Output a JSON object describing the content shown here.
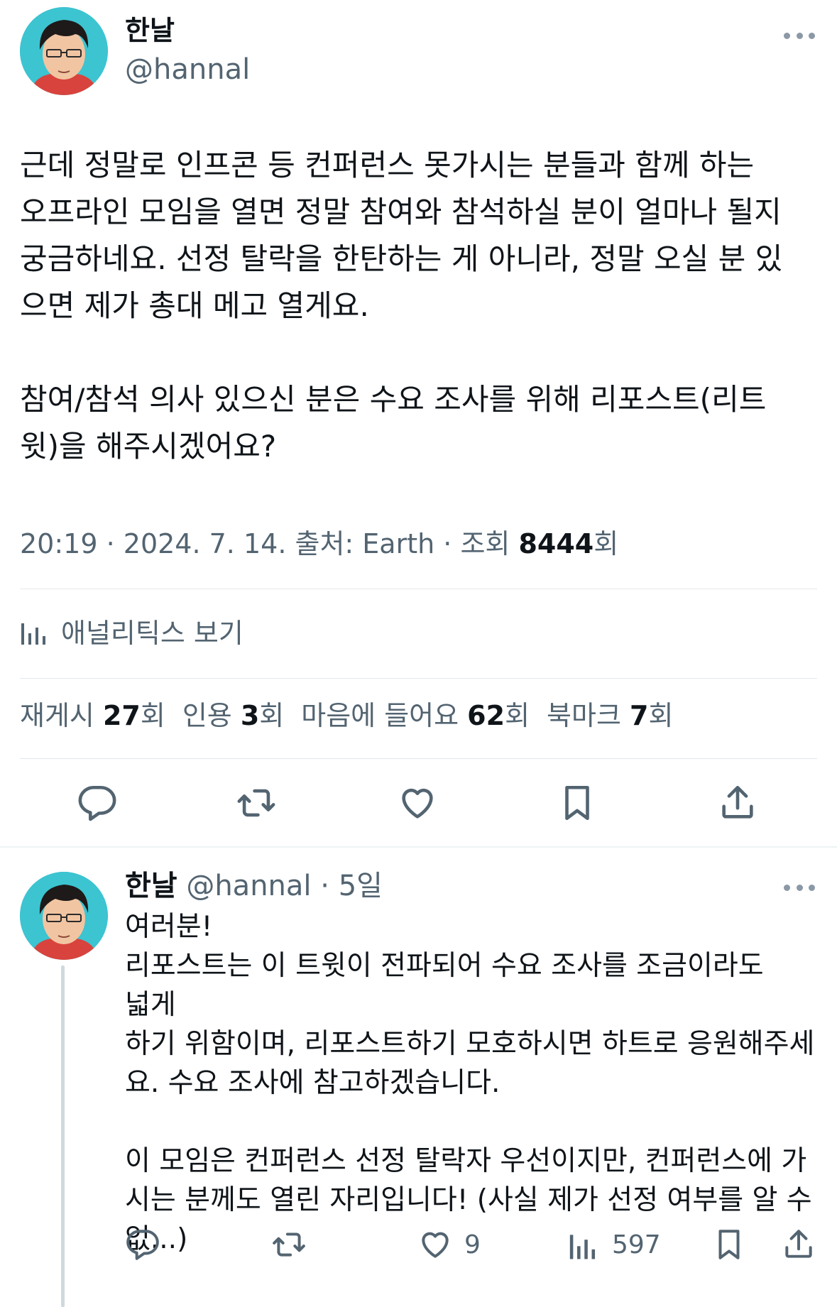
{
  "main_tweet": {
    "display_name": "한날",
    "handle": "@hannal",
    "text": "근데 정말로 인프콘 등 컨퍼런스 못가시는 분들과 함께 하는\n오프라인 모임을 열면 정말 참여와 참석하실 분이 얼마나 될지\n궁금하네요. 선정 탈락을 한탄하는 게 아니라, 정말 오실 분 있\n으면 제가 총대 메고 열게요.\n\n참여/참석 의사 있으신 분은 수요 조사를 위해 리포스트(리트\n윗)을 해주시겠어요?",
    "meta": {
      "time": "20:19",
      "sep1": " · ",
      "date": "2024. 7. 14.",
      "source_label": " 출처: ",
      "source": "Earth",
      "sep2": " · ",
      "views_label": "조회 ",
      "views": "8444",
      "views_unit": "회"
    },
    "analytics_label": "애널리틱스 보기",
    "stats": {
      "reposts_label": "재게시 ",
      "reposts": "27",
      "reposts_unit": "회",
      "quotes_label": "인용 ",
      "quotes": "3",
      "quotes_unit": "회",
      "likes_label": "마음에 들어요 ",
      "likes": "62",
      "likes_unit": "회",
      "bookmarks_label": "북마크 ",
      "bookmarks": "7",
      "bookmarks_unit": "회"
    },
    "actions": [
      "reply-icon",
      "repost-icon",
      "like-icon",
      "bookmark-icon",
      "share-icon"
    ]
  },
  "reply": {
    "display_name": "한날",
    "handle": "@hannal",
    "sep": " · ",
    "time": "5일",
    "text": "여러분!\n리포스트는 이 트윗이 전파되어 수요 조사를 조금이라도 넓게\n하기 위함이며, 리포스트하기 모호하시면 하트로 응원해주세\n요. 수요 조사에 참고하겠습니다.\n\n이 모임은 컨퍼런스 선정 탈락자 우선이지만, 컨퍼런스에 가\n시는 분께도 열린 자리입니다! (사실 제가 선정 여부를 알 수\n없...)",
    "likes": "9",
    "views": "597"
  },
  "colors": {
    "text": "#0f1419",
    "muted": "#536471",
    "divider": "#e4e8eb",
    "avatar_bg": "#3cc4d1"
  }
}
